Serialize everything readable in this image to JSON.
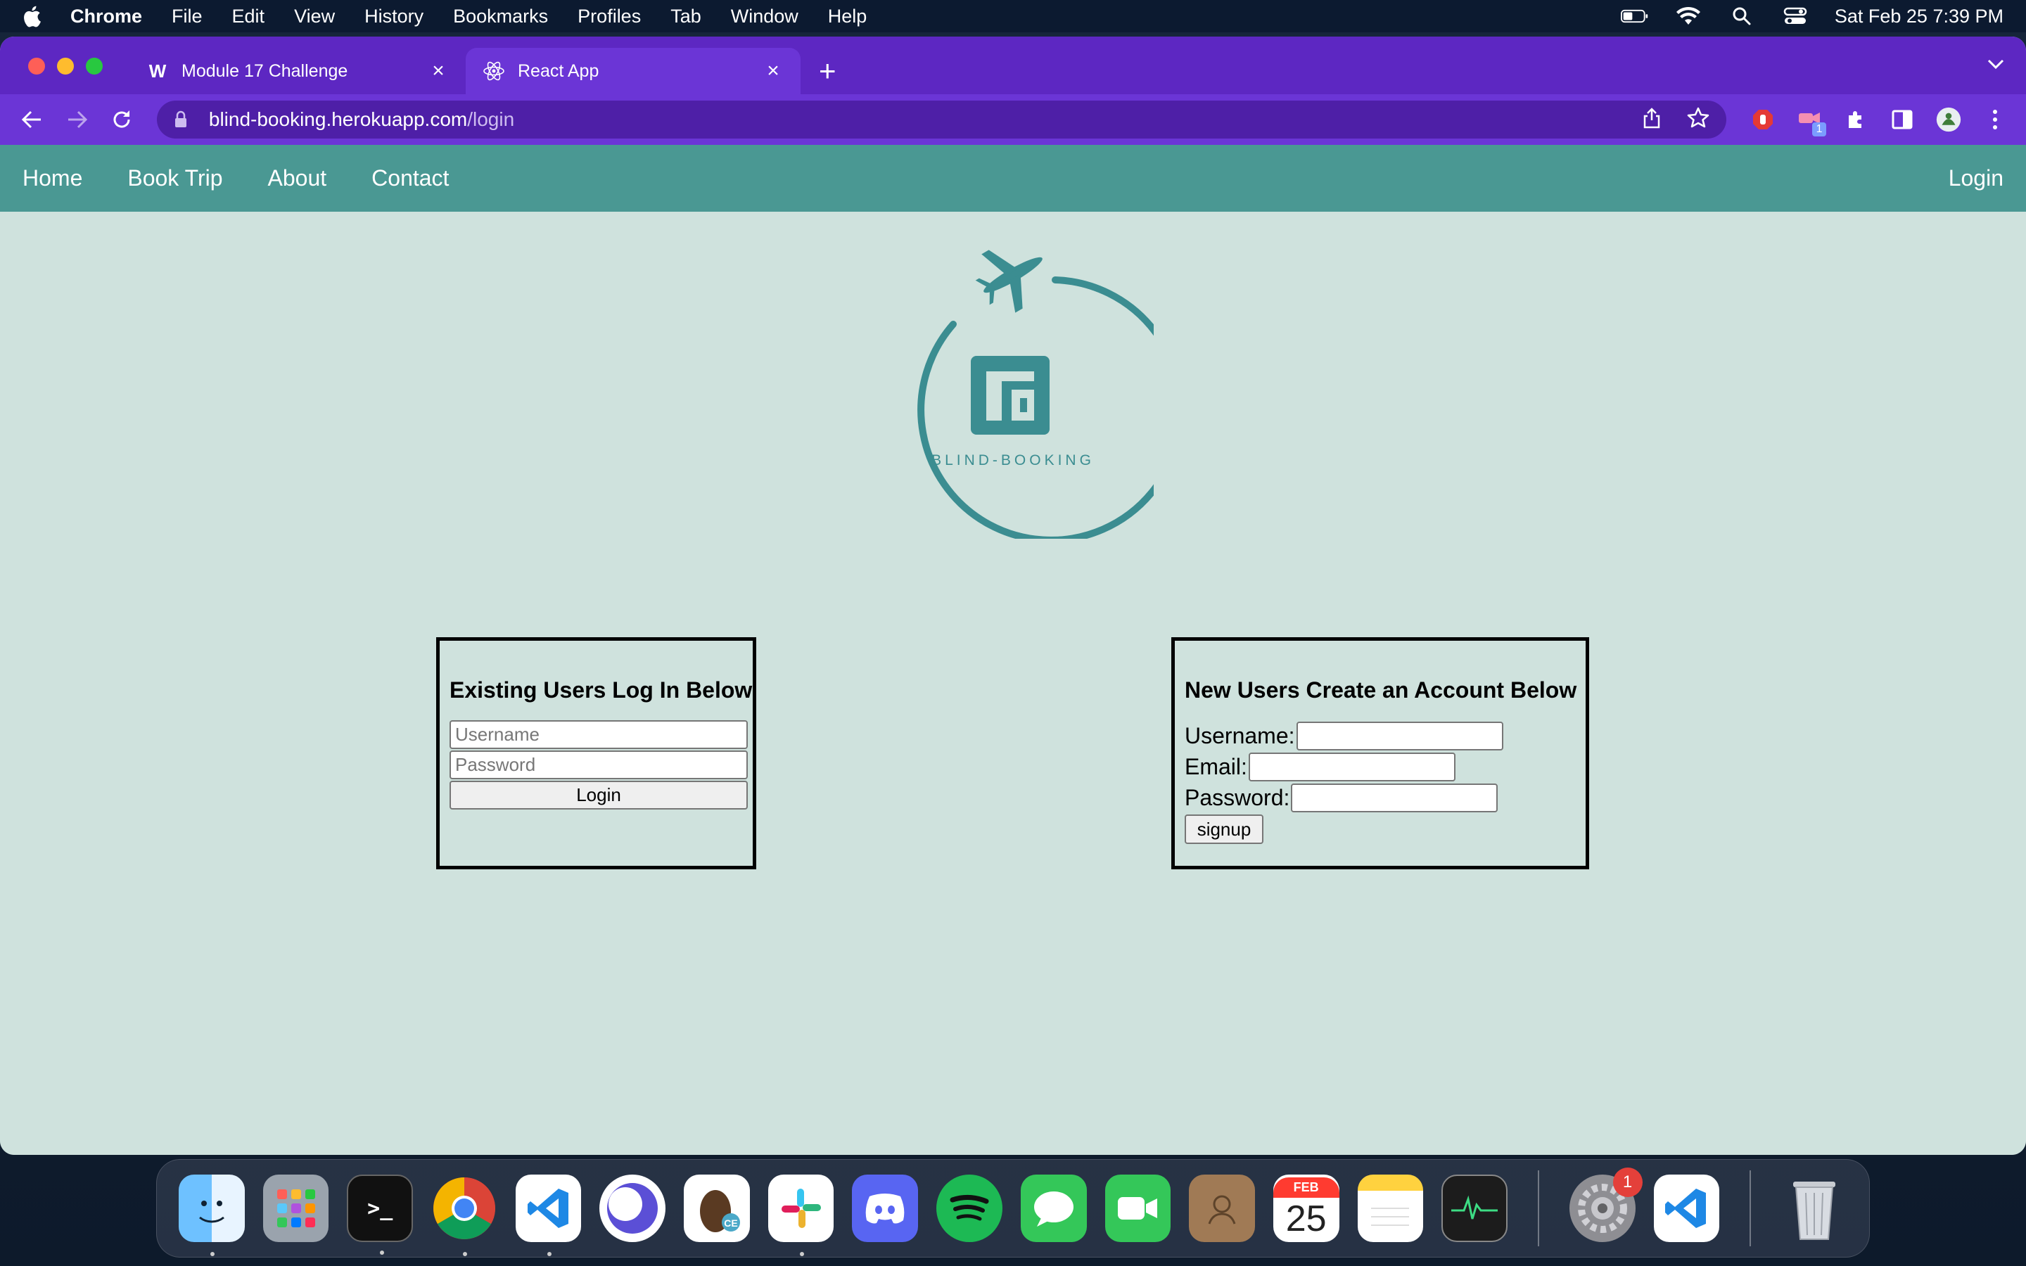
{
  "menubar": {
    "app_name": "Chrome",
    "menus": [
      "File",
      "Edit",
      "View",
      "History",
      "Bookmarks",
      "Profiles",
      "Tab",
      "Window",
      "Help"
    ],
    "clock": "Sat Feb 25  7:39 PM"
  },
  "browser": {
    "tabs": [
      {
        "title": "Module 17 Challenge",
        "favicon": "W"
      },
      {
        "title": "React App",
        "favicon": "react-icon"
      }
    ],
    "url_host": "blind-booking.herokuapp.com",
    "url_path": "/login"
  },
  "site_nav": {
    "links": [
      "Home",
      "Book Trip",
      "About",
      "Contact"
    ],
    "login": "Login"
  },
  "logo": {
    "text": "BLIND-BOOKING"
  },
  "login_box": {
    "heading": "Existing Users Log In Below",
    "username_placeholder": "Username",
    "password_placeholder": "Password",
    "button": "Login"
  },
  "signup_box": {
    "heading": "New Users Create an Account Below",
    "username_label": "Username:",
    "email_label": "Email:",
    "password_label": "Password:",
    "button": "signup"
  },
  "dock": {
    "calendar_month": "FEB",
    "calendar_day": "25",
    "settings_badge": "1",
    "extension_badge": "1",
    "colors": {
      "accent": "#4a9893",
      "tabbar": "#5d27c2",
      "toolbar": "#6b35d6"
    }
  }
}
